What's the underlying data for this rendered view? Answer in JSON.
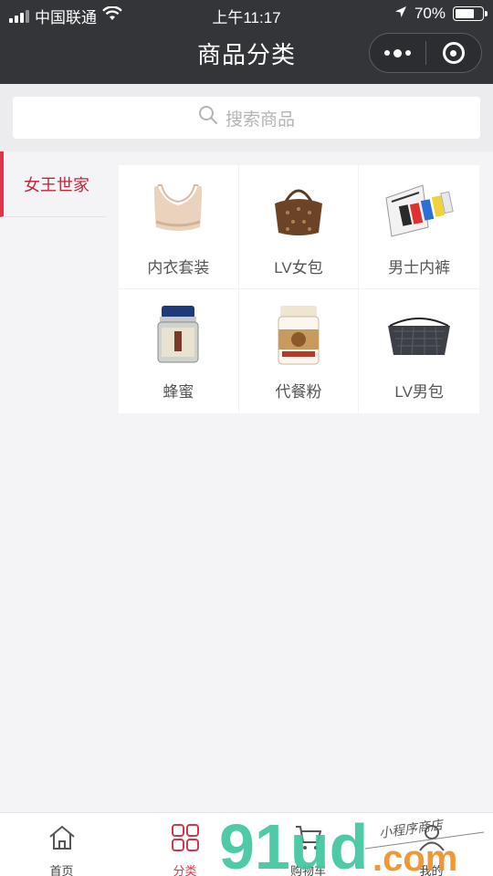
{
  "status_bar": {
    "carrier": "中国联通",
    "time": "上午11:17",
    "battery_text": "70%",
    "battery_level": 0.7
  },
  "nav": {
    "title": "商品分类"
  },
  "search": {
    "placeholder": "搜索商品"
  },
  "sidebar": {
    "items": [
      {
        "label": "女王世家",
        "active": true
      }
    ]
  },
  "categories": [
    {
      "label": "内衣套装",
      "icon": "underwear-set-image"
    },
    {
      "label": "LV女包",
      "icon": "lv-handbag-image"
    },
    {
      "label": "男士内裤",
      "icon": "mens-underwear-image"
    },
    {
      "label": "蜂蜜",
      "icon": "honey-jar-image"
    },
    {
      "label": "代餐粉",
      "icon": "meal-powder-image"
    },
    {
      "label": "LV男包",
      "icon": "lv-mens-bag-image"
    }
  ],
  "tabbar": {
    "items": [
      {
        "label": "首页",
        "icon": "home-icon"
      },
      {
        "label": "分类",
        "icon": "category-icon",
        "active": true
      },
      {
        "label": "购物车",
        "icon": "cart-icon"
      },
      {
        "label": "我的",
        "icon": "user-icon"
      }
    ]
  },
  "watermark": {
    "logo": "91ud.com",
    "tagline": "小程序商店"
  },
  "colors": {
    "accent": "#d4374a",
    "nav_bg": "#333539",
    "watermark_green": "#3fc79f",
    "watermark_orange": "#f0922e"
  }
}
